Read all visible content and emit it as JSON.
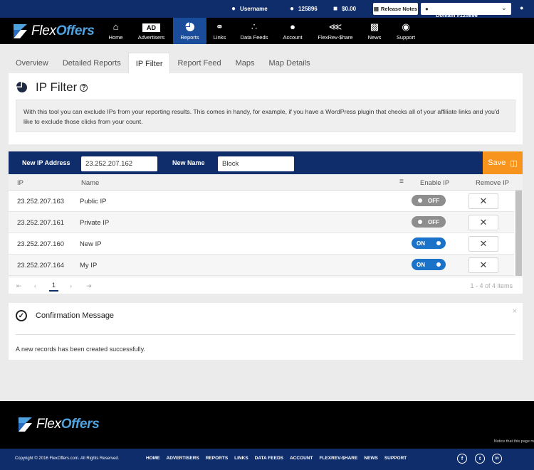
{
  "topbar": {
    "username": "Username",
    "account_id": "125896",
    "balance": "$0.00",
    "release_notes": "Release Notes",
    "domain": "Domain #125896"
  },
  "nav": {
    "brand_flex": "Flex",
    "brand_offers": "Offers",
    "ad_badge": "AD",
    "items": [
      "Home",
      "Advertisers",
      "Reports",
      "Links",
      "Data Feeds",
      "Account",
      "FlexRev-$hare",
      "News",
      "Support"
    ],
    "active": "Reports"
  },
  "tabs": [
    "Overview",
    "Detailed Reports",
    "IP Filter",
    "Report Feed",
    "Maps",
    "Map Details"
  ],
  "active_tab": "IP Filter",
  "page": {
    "title": "IP Filter",
    "help_glyph": "?",
    "description": "With this tool you can exclude IPs from your reporting results. This comes in handy, for example, if you have a WordPress plugin that checks all of your affiliate links and you'd like to exclude those clicks from your count."
  },
  "form": {
    "ip_label": "New IP Address",
    "ip_value": "23.252.207.162",
    "name_label": "New Name",
    "name_value": "Block",
    "save_label": "Save"
  },
  "grid": {
    "columns": [
      "IP",
      "Name",
      "Enable IP",
      "Remove IP"
    ],
    "rows": [
      {
        "ip": "23.252.207.163",
        "name": "Public IP",
        "enabled": "OFF"
      },
      {
        "ip": "23.252.207.161",
        "name": "Private IP",
        "enabled": "OFF"
      },
      {
        "ip": "23.252.207.160",
        "name": "New IP",
        "enabled": "ON"
      },
      {
        "ip": "23.252.207.164",
        "name": "My IP",
        "enabled": "ON"
      }
    ],
    "remove_glyph": "✕",
    "pager": {
      "current_page": "1",
      "summary": "1 - 4 of 4 items"
    }
  },
  "confirmation": {
    "title": "Confirmation Message",
    "message": "A new records has been created successfully.",
    "close_glyph": "×"
  },
  "footer": {
    "brand_flex": "Flex",
    "brand_offers": "Offers",
    "notice": "Notice that this page m",
    "copyright": "Copyright © 2016 FlexOffers.com. All Rights Reserved.",
    "links": [
      "HOME",
      "ADVERTISERS",
      "REPORTS",
      "LINKS",
      "DATA FEEDS",
      "ACCOUNT",
      "FLEXREV-$HARE",
      "NEWS",
      "SUPPORT"
    ],
    "social": [
      "f",
      "t",
      "in"
    ]
  },
  "colors": {
    "navy": "#0f2d6b",
    "active_nav": "#1a4c9c",
    "save_orange": "#f7941d",
    "toggle_on": "#1a73c8",
    "toggle_off": "#8e8e8e"
  }
}
